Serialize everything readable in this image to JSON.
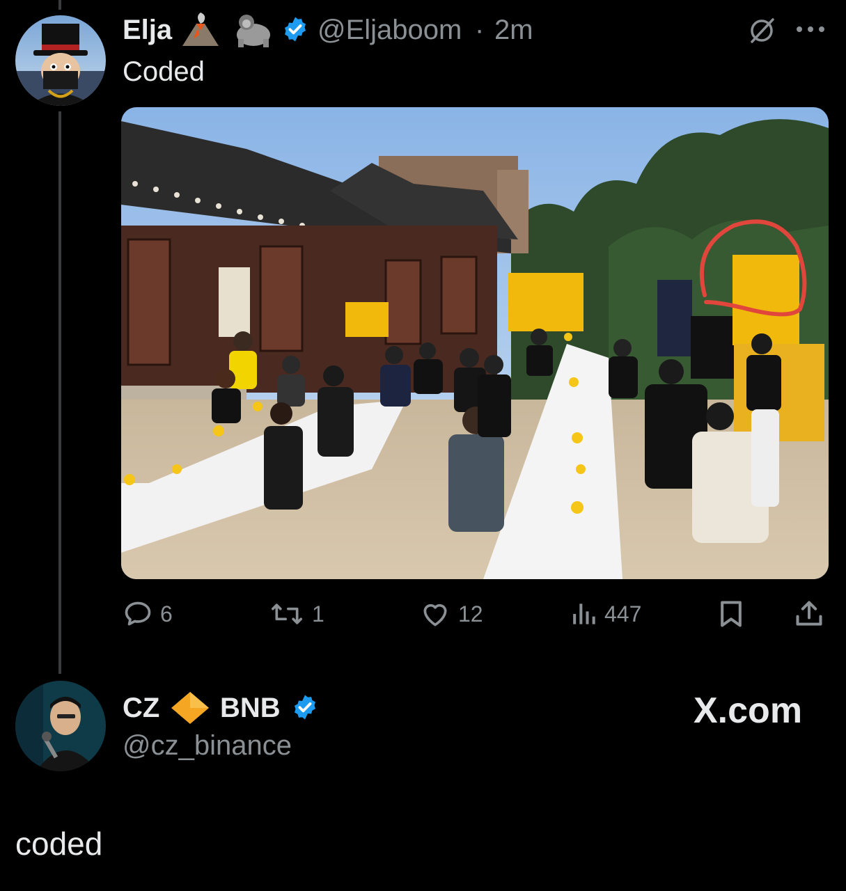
{
  "tweet": {
    "display_name": "Elja",
    "name_emojis": [
      "volcano",
      "gorilla"
    ],
    "handle": "@Eljaboom",
    "separator": "·",
    "time": "2m",
    "text": "Coded",
    "image_icons": [
      "grok-icon",
      "more-icon"
    ],
    "actions": {
      "replies": "6",
      "reposts": "1",
      "likes": "12",
      "views": "447"
    }
  },
  "quoted_account": {
    "display_name_first": "CZ",
    "display_name_emoji": "diamond",
    "display_name_second": "BNB",
    "handle": "@cz_binance",
    "brand": "X.com"
  },
  "caption": "coded",
  "colors": {
    "background": "#000000",
    "text": "#e7e9ea",
    "muted": "#8b9095",
    "verified": "#1d9bf0",
    "bnb_yellow": "#f0b90b",
    "circle_red": "#e0463c"
  }
}
